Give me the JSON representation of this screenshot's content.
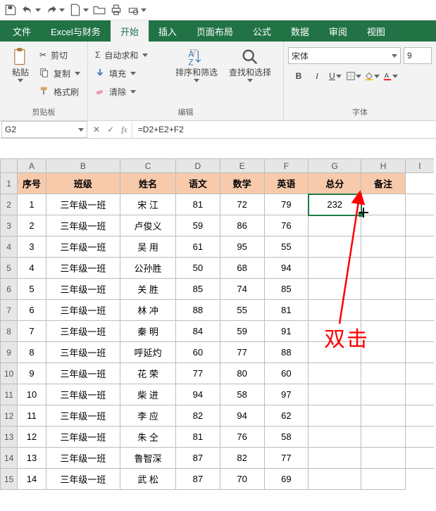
{
  "qat": {
    "save": "save",
    "undo": "undo",
    "redo": "redo",
    "new": "new",
    "open": "open",
    "print": "print",
    "printpreview": "print-preview"
  },
  "tabs": {
    "file": "文件",
    "excel_finance": "Excel与财务",
    "start": "开始",
    "insert": "插入",
    "layout": "页面布局",
    "formula": "公式",
    "data": "数据",
    "review": "审阅",
    "view": "视图"
  },
  "ribbon": {
    "clipboard": {
      "paste": "粘贴",
      "cut": "剪切",
      "copy": "复制",
      "format_painter": "格式刷",
      "group_label": "剪贴板"
    },
    "edit": {
      "autosum": "自动求和",
      "fill": "填充",
      "clear": "清除",
      "sortfilter": "排序和筛选",
      "findselect": "查找和选择",
      "group_label": "编辑"
    },
    "font": {
      "name": "宋体",
      "size": "9",
      "group_label": "字体"
    }
  },
  "formula_bar": {
    "name_box": "G2",
    "formula": "=D2+E2+F2"
  },
  "columns": [
    "A",
    "B",
    "C",
    "D",
    "E",
    "F",
    "G",
    "H",
    "I"
  ],
  "header_row": {
    "a": "序号",
    "b": "班级",
    "c": "姓名",
    "d": "语文",
    "e": "数学",
    "f": "英语",
    "g": "总分",
    "h": "备注"
  },
  "rows": [
    {
      "n": "1",
      "a": "1",
      "b": "三年级一班",
      "c": "宋  江",
      "d": "81",
      "e": "72",
      "f": "79",
      "g": "232",
      "h": ""
    },
    {
      "n": "2",
      "a": "2",
      "b": "三年级一班",
      "c": "卢俊义",
      "d": "59",
      "e": "86",
      "f": "76",
      "g": "",
      "h": ""
    },
    {
      "n": "3",
      "a": "3",
      "b": "三年级一班",
      "c": "吴  用",
      "d": "61",
      "e": "95",
      "f": "55",
      "g": "",
      "h": ""
    },
    {
      "n": "4",
      "a": "4",
      "b": "三年级一班",
      "c": "公孙胜",
      "d": "50",
      "e": "68",
      "f": "94",
      "g": "",
      "h": ""
    },
    {
      "n": "5",
      "a": "5",
      "b": "三年级一班",
      "c": "关  胜",
      "d": "85",
      "e": "74",
      "f": "85",
      "g": "",
      "h": ""
    },
    {
      "n": "6",
      "a": "6",
      "b": "三年级一班",
      "c": "林  冲",
      "d": "88",
      "e": "55",
      "f": "81",
      "g": "",
      "h": ""
    },
    {
      "n": "7",
      "a": "7",
      "b": "三年级一班",
      "c": "秦  明",
      "d": "84",
      "e": "59",
      "f": "91",
      "g": "",
      "h": ""
    },
    {
      "n": "8",
      "a": "8",
      "b": "三年级一班",
      "c": "呼延灼",
      "d": "60",
      "e": "77",
      "f": "88",
      "g": "",
      "h": ""
    },
    {
      "n": "9",
      "a": "9",
      "b": "三年级一班",
      "c": "花  荣",
      "d": "77",
      "e": "80",
      "f": "60",
      "g": "",
      "h": ""
    },
    {
      "n": "10",
      "a": "10",
      "b": "三年级一班",
      "c": "柴  进",
      "d": "94",
      "e": "58",
      "f": "97",
      "g": "",
      "h": ""
    },
    {
      "n": "11",
      "a": "11",
      "b": "三年级一班",
      "c": "李  应",
      "d": "82",
      "e": "94",
      "f": "62",
      "g": "",
      "h": ""
    },
    {
      "n": "12",
      "a": "12",
      "b": "三年级一班",
      "c": "朱  仝",
      "d": "81",
      "e": "76",
      "f": "58",
      "g": "",
      "h": ""
    },
    {
      "n": "13",
      "a": "13",
      "b": "三年级一班",
      "c": "鲁智深",
      "d": "87",
      "e": "82",
      "f": "77",
      "g": "",
      "h": ""
    },
    {
      "n": "14",
      "a": "14",
      "b": "三年级一班",
      "c": "武  松",
      "d": "87",
      "e": "70",
      "f": "69",
      "g": "",
      "h": ""
    }
  ],
  "annotation": {
    "text": "双击"
  },
  "chart_data": {
    "type": "table",
    "title": "",
    "columns": [
      "序号",
      "班级",
      "姓名",
      "语文",
      "数学",
      "英语",
      "总分",
      "备注"
    ],
    "rows": [
      [
        1,
        "三年级一班",
        "宋 江",
        81,
        72,
        79,
        232,
        ""
      ],
      [
        2,
        "三年级一班",
        "卢俊义",
        59,
        86,
        76,
        null,
        ""
      ],
      [
        3,
        "三年级一班",
        "吴 用",
        61,
        95,
        55,
        null,
        ""
      ],
      [
        4,
        "三年级一班",
        "公孙胜",
        50,
        68,
        94,
        null,
        ""
      ],
      [
        5,
        "三年级一班",
        "关 胜",
        85,
        74,
        85,
        null,
        ""
      ],
      [
        6,
        "三年级一班",
        "林 冲",
        88,
        55,
        81,
        null,
        ""
      ],
      [
        7,
        "三年级一班",
        "秦 明",
        84,
        59,
        91,
        null,
        ""
      ],
      [
        8,
        "三年级一班",
        "呼延灼",
        60,
        77,
        88,
        null,
        ""
      ],
      [
        9,
        "三年级一班",
        "花 荣",
        77,
        80,
        60,
        null,
        ""
      ],
      [
        10,
        "三年级一班",
        "柴 进",
        94,
        58,
        97,
        null,
        ""
      ],
      [
        11,
        "三年级一班",
        "李 应",
        82,
        94,
        62,
        null,
        ""
      ],
      [
        12,
        "三年级一班",
        "朱 仝",
        81,
        76,
        58,
        null,
        ""
      ],
      [
        13,
        "三年级一班",
        "鲁智深",
        87,
        82,
        77,
        null,
        ""
      ],
      [
        14,
        "三年级一班",
        "武 松",
        87,
        70,
        69,
        null,
        ""
      ]
    ],
    "formula_cell": "G2",
    "formula": "=D2+E2+F2"
  }
}
